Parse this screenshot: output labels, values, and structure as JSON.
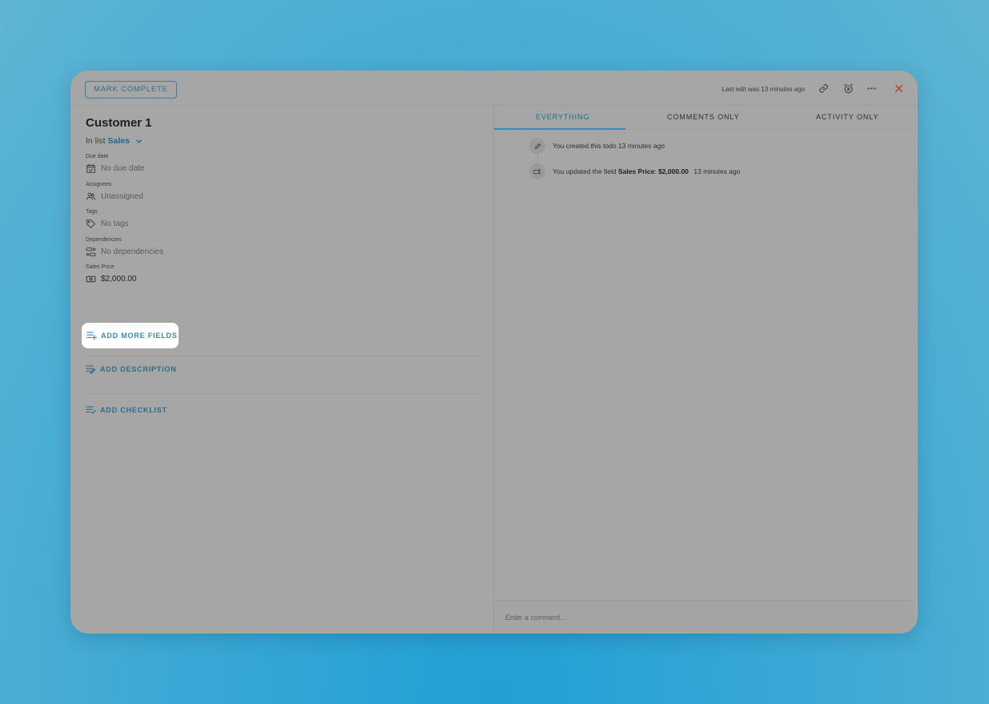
{
  "toolbar": {
    "mark_complete_label": "MARK COMPLETE",
    "last_edit": "Last edit was 13 minutes ago"
  },
  "todo": {
    "title": "Customer 1",
    "in_list_prefix": "In list",
    "list_name": "Sales"
  },
  "fields": {
    "due_date": {
      "label": "Due date",
      "value": "No due date"
    },
    "assignees": {
      "label": "Assignees",
      "value": "Unassigned"
    },
    "tags": {
      "label": "Tags",
      "value": "No tags"
    },
    "dependencies": {
      "label": "Dependencies",
      "value": "No dependencies"
    },
    "sales_price": {
      "label": "Sales Price",
      "value": "$2,000.00"
    }
  },
  "actions": {
    "add_more_fields": "ADD MORE FIELDS",
    "add_description": "ADD DESCRIPTION",
    "add_checklist": "ADD CHECKLIST"
  },
  "tabs": [
    {
      "label": "EVERYTHING",
      "active": true
    },
    {
      "label": "COMMENTS ONLY",
      "active": false
    },
    {
      "label": "ACTIVITY ONLY",
      "active": false
    }
  ],
  "activity": [
    {
      "icon": "pencil-icon",
      "text": "You created this todo 13 minutes ago"
    },
    {
      "icon": "field-icon",
      "prefix": "You updated the field",
      "field": "Sales Price",
      "sep": ":",
      "value": "$2,000.00",
      "time": "13 minutes ago"
    }
  ],
  "comment": {
    "placeholder": "Enter a comment..."
  },
  "colors": {
    "accent": "#2c8fbb",
    "close": "#c0392b",
    "highlight": "#ffffff"
  }
}
